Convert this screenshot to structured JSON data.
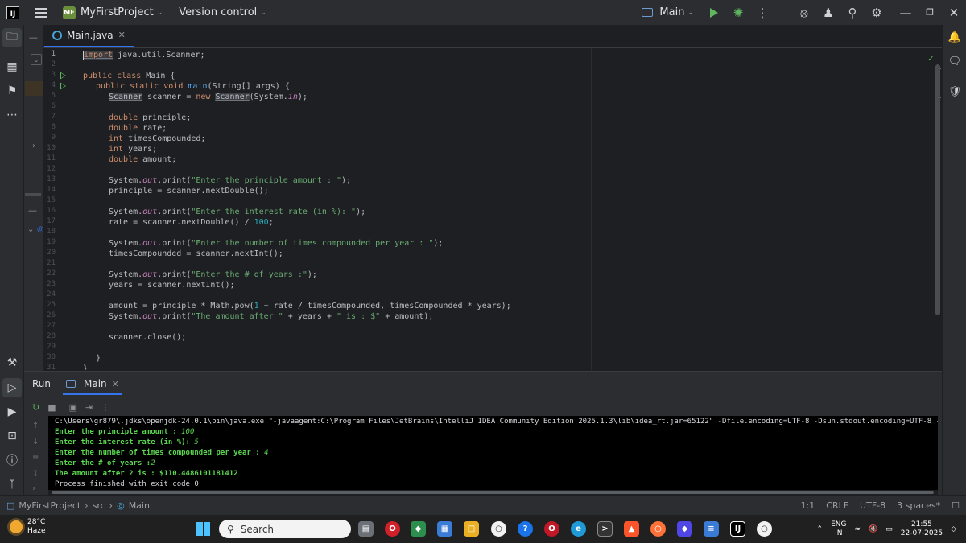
{
  "titlebar": {
    "project_badge": "MF",
    "project_name": "MyFirstProject",
    "vcs": "Version control",
    "run_config": "Main"
  },
  "editor": {
    "tab_label": "Main.java",
    "lines": [
      {
        "n": "1"
      },
      {
        "n": "2"
      },
      {
        "n": "3"
      },
      {
        "n": "4"
      },
      {
        "n": "5"
      },
      {
        "n": "6"
      },
      {
        "n": "7"
      },
      {
        "n": "8"
      },
      {
        "n": "9"
      },
      {
        "n": "10"
      },
      {
        "n": "11"
      },
      {
        "n": "12"
      },
      {
        "n": "13"
      },
      {
        "n": "14"
      },
      {
        "n": "15"
      },
      {
        "n": "16"
      },
      {
        "n": "17"
      },
      {
        "n": "18"
      },
      {
        "n": "19"
      },
      {
        "n": "20"
      },
      {
        "n": "21"
      },
      {
        "n": "22"
      },
      {
        "n": "23"
      },
      {
        "n": "24"
      },
      {
        "n": "25"
      },
      {
        "n": "26"
      },
      {
        "n": "27"
      },
      {
        "n": "28"
      },
      {
        "n": "29"
      },
      {
        "n": "30"
      },
      {
        "n": "31"
      }
    ],
    "code": {
      "l1_kw": "import",
      "l1_rest": " java.util.Scanner;",
      "l3_kw": "public class",
      "l3_rest": " Main {",
      "l4_kw": "public static void",
      "l4_m": "main",
      "l4_rest": "(String[] args) {",
      "l5_type": "Scanner",
      "l5_a": " scanner = ",
      "l5_kw": "new",
      "l5_type2": "Scanner",
      "l5_b": "(System.",
      "l5_in": "in",
      "l5_c": ");",
      "l7_kw": "double",
      "l7_rest": " principle;",
      "l8_kw": "double",
      "l8_rest": " rate;",
      "l9_kw": "int",
      "l9_rest": " timesCompounded;",
      "l10_kw": "int",
      "l10_rest": " years;",
      "l11_kw": "double",
      "l11_rest": " amount;",
      "l13_a": "System.",
      "l13_out": "out",
      "l13_b": ".print(",
      "l13_str": "\"Enter the principle amount : \"",
      "l13_c": ");",
      "l14": "principle = scanner.nextDouble();",
      "l16_a": "System.",
      "l16_out": "out",
      "l16_b": ".print(",
      "l16_str": "\"Enter the interest rate (in %): \"",
      "l16_c": ");",
      "l17_a": "rate = scanner.nextDouble() / ",
      "l17_num": "100",
      "l17_b": ";",
      "l19_a": "System.",
      "l19_out": "out",
      "l19_b": ".print(",
      "l19_str": "\"Enter the number of times compounded per year : \"",
      "l19_c": ");",
      "l20": "timesCompounded = scanner.nextInt();",
      "l22_a": "System.",
      "l22_out": "out",
      "l22_b": ".print(",
      "l22_str": "\"Enter the # of years :\"",
      "l22_c": ");",
      "l23": "years = scanner.nextInt();",
      "l25_a": "amount = principle * Math.pow(",
      "l25_num": "1",
      "l25_b": " + rate / timesCompounded, timesCompounded * years);",
      "l26_a": "System.",
      "l26_out": "out",
      "l26_b": ".print(",
      "l26_str1": "\"The amount after \"",
      "l26_c": " + years + ",
      "l26_str2": "\" is : $\"",
      "l26_d": " + amount);",
      "l28": "scanner.close();",
      "l30": "}",
      "l31": "}"
    }
  },
  "run_panel": {
    "title": "Run",
    "tab_label": "Main",
    "console": {
      "cmd": "C:\\Users\\gr879\\.jdks\\openjdk-24.0.1\\bin\\java.exe \"-javaagent:C:\\Program Files\\JetBrains\\IntelliJ IDEA Community Edition 2025.1.3\\lib\\idea_rt.jar=65122\" -Dfile.encoding=UTF-8 -Dsun.stdout.encoding=UTF-8 -Dsun.st",
      "p1": "Enter the principle amount : ",
      "i1": "100",
      "p2": "Enter the interest rate (in %): ",
      "i2": "5",
      "p3": "Enter the number of times compounded per year : ",
      "i3": "4",
      "p4": "Enter the # of years :",
      "i4": "2",
      "result": "The amount after 2 is : $110.4486101181412",
      "finish": "Process finished with exit code 0"
    }
  },
  "statusbar": {
    "crumb_project": "MyFirstProject",
    "crumb_src": "src",
    "crumb_file": "Main",
    "position": "1:1",
    "line_sep": "CRLF",
    "encoding": "UTF-8",
    "indent": "3 spaces*"
  },
  "taskbar": {
    "temp": "28°C",
    "weather": "Haze",
    "search_placeholder": "Search",
    "lang": "ENG",
    "lang_region": "IN",
    "time": "21:55",
    "date": "22-07-2025"
  }
}
